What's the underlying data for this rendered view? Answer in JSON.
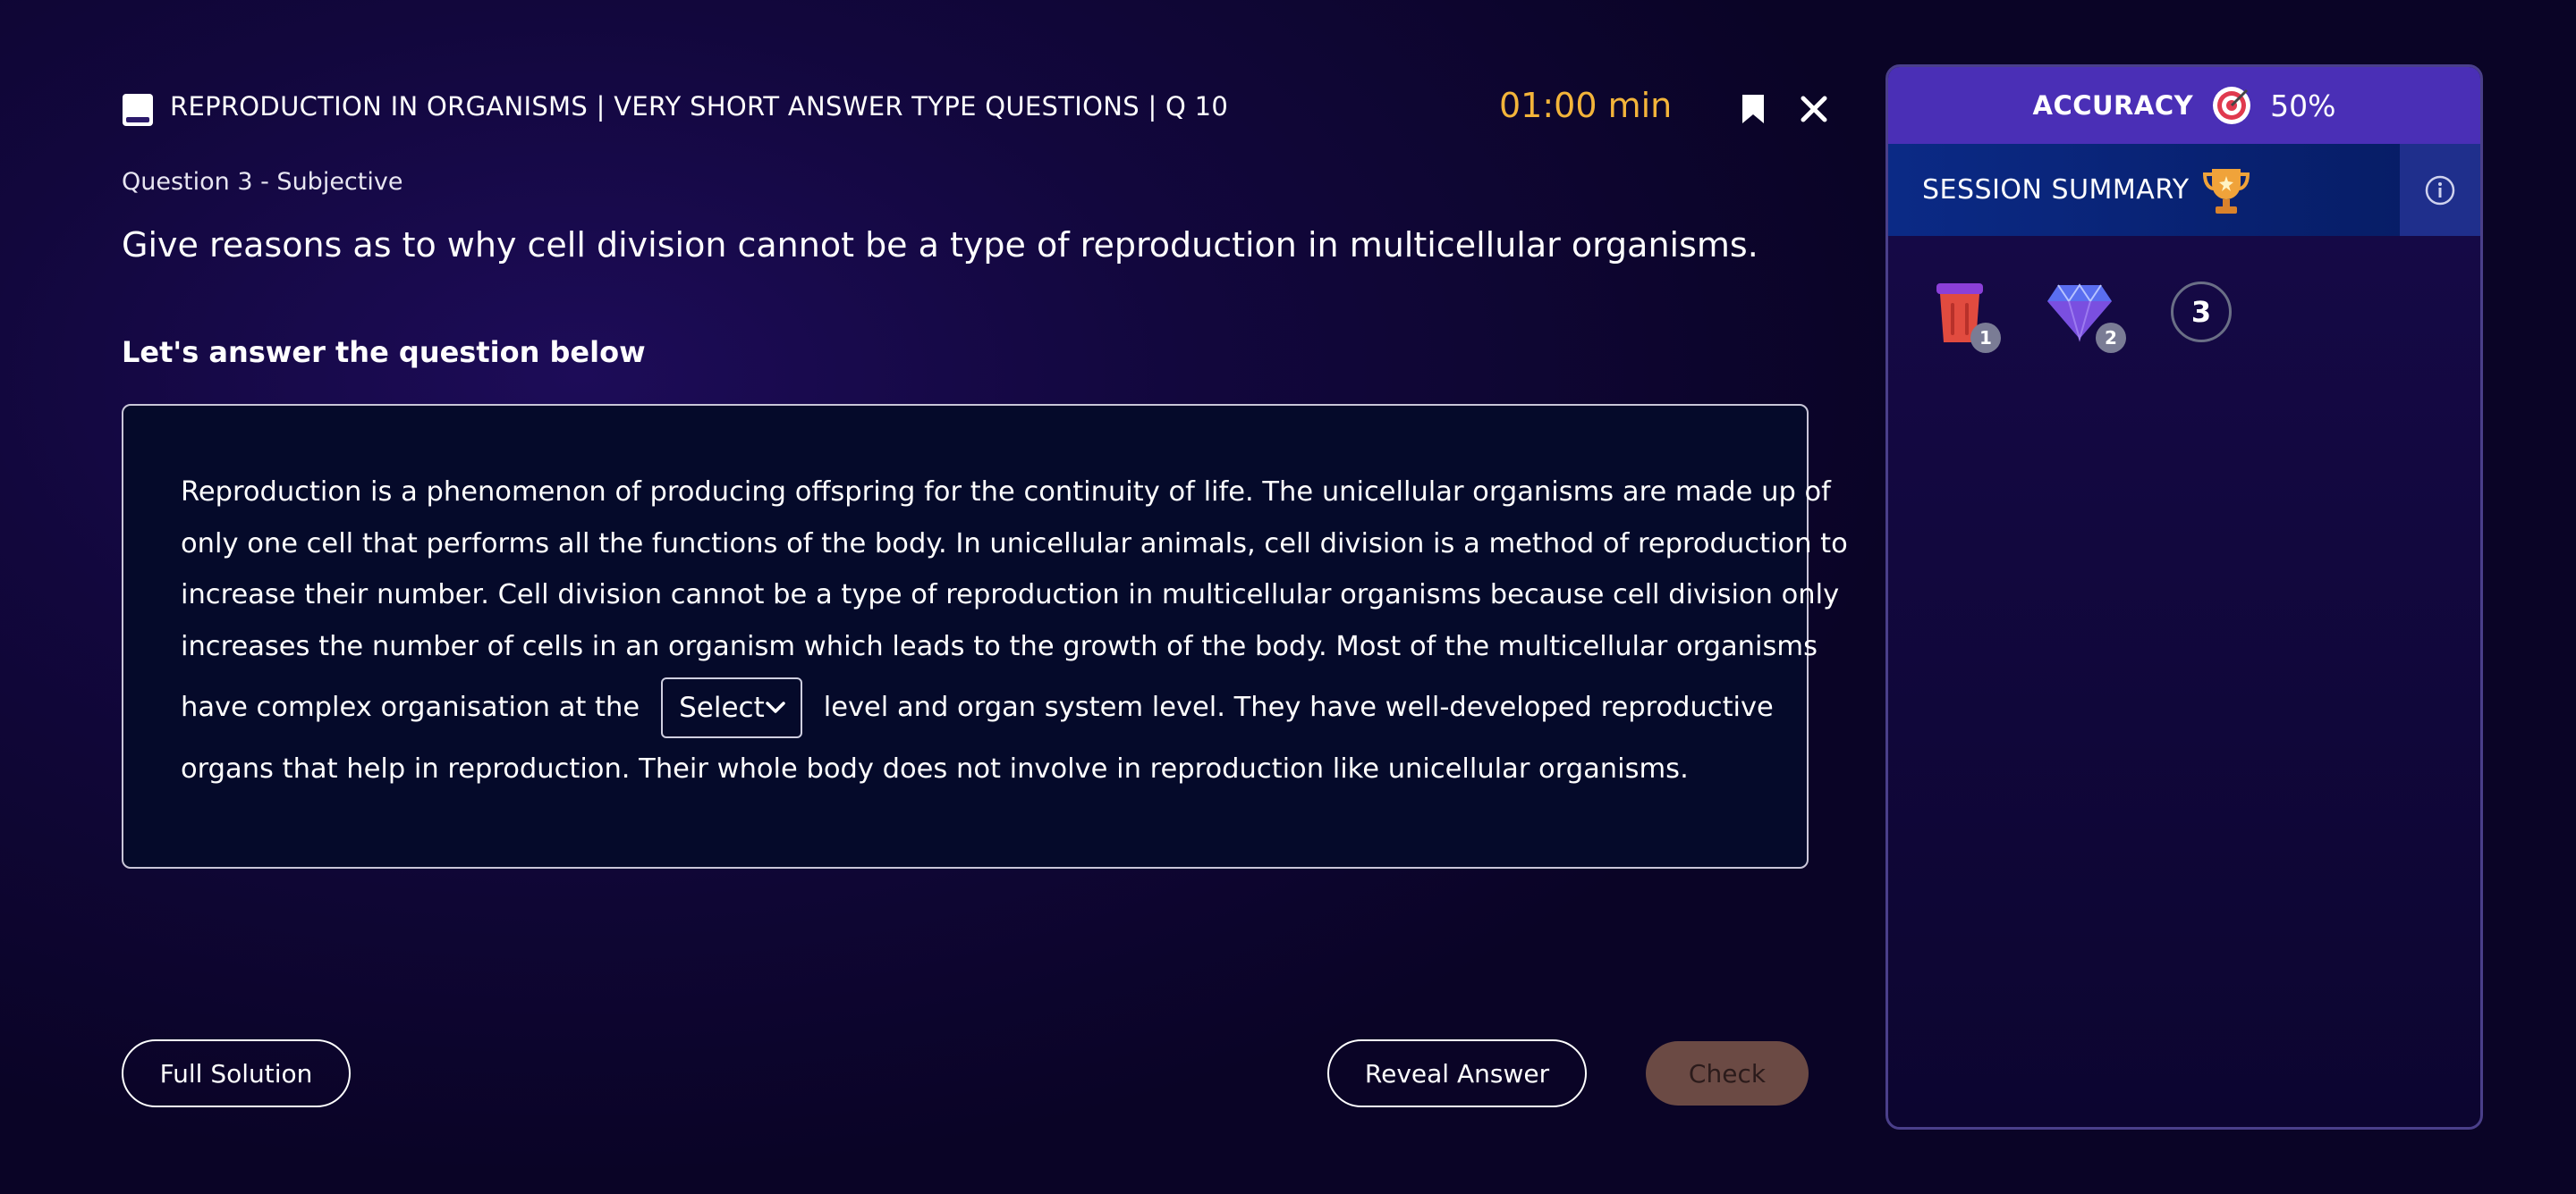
{
  "header": {
    "title": "REPRODUCTION IN ORGANISMS | VERY SHORT ANSWER TYPE QUESTIONS | Q 10",
    "timer": "01:00 min",
    "book_icon": "book-icon",
    "bookmark_icon": "bookmark-icon",
    "close_icon": "close-icon"
  },
  "question": {
    "meta": "Question 3 - Subjective",
    "text": "Give reasons as to why cell division cannot be a type of reproduction in multicellular organisms."
  },
  "answer": {
    "heading": "Let's answer the question below",
    "lines": [
      "Reproduction is a phenomenon of producing offspring for the continuity of life. The unicellular organisms are made up of",
      "only one cell that performs all the functions of the body. In unicellular animals, cell division is a method of reproduction to",
      "increase their number. Cell division cannot be a type of reproduction in multicellular organisms because cell division only",
      "increases the number of cells in an organism which leads to the growth of the body. Most of the multicellular organisms"
    ],
    "before_select": "have complex organisation at the",
    "select_value": "Select",
    "after_select": "level and organ system level. They have well-developed reproductive",
    "last_line": "organs that help in reproduction. Their whole body does not involve in reproduction like unicellular organisms."
  },
  "buttons": {
    "full_solution": "Full Solution",
    "reveal_answer": "Reveal Answer",
    "check": "Check"
  },
  "sidebar": {
    "accuracy_label": "ACCURACY",
    "accuracy_value": "50%",
    "session_summary": "SESSION SUMMARY",
    "stats": [
      {
        "icon": "trash-icon",
        "count": "1"
      },
      {
        "icon": "gem-icon",
        "count": "2"
      }
    ],
    "question_count": "3"
  },
  "colors": {
    "timer": "#f3b43a",
    "accuracy_bar": "#4a2fb6",
    "summary_bar": "#0b2a86",
    "check_button": "#6b4a44"
  }
}
